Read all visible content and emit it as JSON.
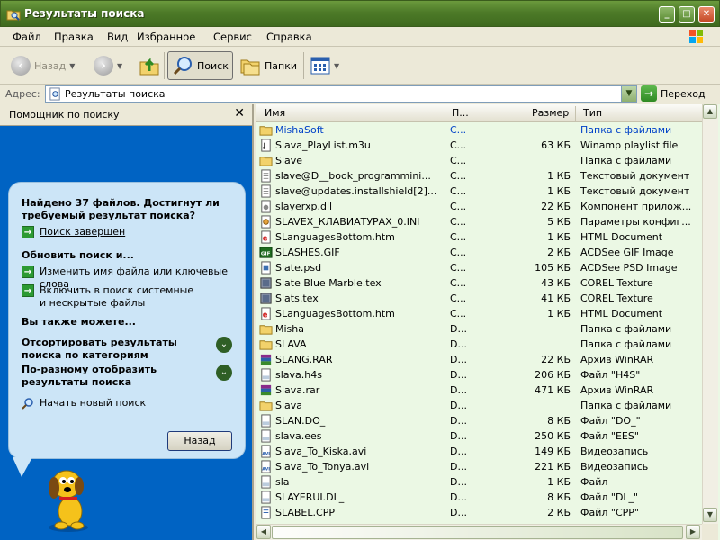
{
  "window": {
    "title": "Результаты поиска"
  },
  "menu": [
    "Файл",
    "Правка",
    "Вид",
    "Избранное",
    "Сервис",
    "Справка"
  ],
  "toolbar": {
    "back": "Назад",
    "search": "Поиск",
    "folders": "Папки"
  },
  "address": {
    "label": "Адрес:",
    "value": "Результаты поиска",
    "go": "Переход"
  },
  "left_panel": {
    "header": "Помощник по поиску",
    "found_text": "Найдено 37 файлов. Достигнут ли требуемый результат поиска?",
    "search_done": "Поиск завершен",
    "refine_title": "Обновить поиск и...",
    "refine_items": [
      "Изменить имя файла или ключевые слова",
      "Включить в поиск системные и нескрытые файлы"
    ],
    "also_title": "Вы также можете...",
    "sort_label": "Отсортировать результаты поиска по категориям",
    "view_label": "По-разному отобразить результаты поиска",
    "new_search": "Начать новый поиск",
    "back_button": "Назад"
  },
  "columns": {
    "name": "Имя",
    "path": "П...",
    "size": "Размер",
    "type": "Тип"
  },
  "files": [
    {
      "name": "MishaSoft",
      "path": "C...",
      "size": "",
      "type": "Папка с файлами",
      "icon": "folder-icon",
      "selected": true
    },
    {
      "name": "Slava_PlayList.m3u",
      "path": "C...",
      "size": "63 КБ",
      "type": "Winamp playlist file",
      "icon": "playlist-icon"
    },
    {
      "name": "Slave",
      "path": "C...",
      "size": "",
      "type": "Папка с файлами",
      "icon": "folder-icon"
    },
    {
      "name": "slave@D__book_programmini...",
      "path": "C...",
      "size": "1 КБ",
      "type": "Текстовый документ",
      "icon": "text-document-icon"
    },
    {
      "name": "slave@updates.installshield[2]...",
      "path": "C...",
      "size": "1 КБ",
      "type": "Текстовый документ",
      "icon": "text-document-icon"
    },
    {
      "name": "slayerxp.dll",
      "path": "C...",
      "size": "22 КБ",
      "type": "Компонент прилож...",
      "icon": "dll-icon"
    },
    {
      "name": "SLAVEX_КЛАВИАТУРАХ_0.INI",
      "path": "C...",
      "size": "5 КБ",
      "type": "Параметры конфиг...",
      "icon": "ini-icon"
    },
    {
      "name": "SLanguagesBottom.htm",
      "path": "C...",
      "size": "1 КБ",
      "type": "HTML Document",
      "icon": "html-icon"
    },
    {
      "name": "SLASHES.GIF",
      "path": "C...",
      "size": "2 КБ",
      "type": "ACDSee GIF Image",
      "icon": "gif-icon"
    },
    {
      "name": "Slate.psd",
      "path": "C...",
      "size": "105 КБ",
      "type": "ACDSee PSD Image",
      "icon": "psd-icon"
    },
    {
      "name": "Slate Blue Marble.tex",
      "path": "C...",
      "size": "43 КБ",
      "type": "COREL Texture",
      "icon": "texture-icon"
    },
    {
      "name": "Slats.tex",
      "path": "C...",
      "size": "41 КБ",
      "type": "COREL Texture",
      "icon": "texture-icon"
    },
    {
      "name": "SLanguagesBottom.htm",
      "path": "C...",
      "size": "1 КБ",
      "type": "HTML Document",
      "icon": "html-icon"
    },
    {
      "name": "Misha",
      "path": "D...",
      "size": "",
      "type": "Папка с файлами",
      "icon": "folder-icon"
    },
    {
      "name": "SLAVA",
      "path": "D...",
      "size": "",
      "type": "Папка с файлами",
      "icon": "folder-icon"
    },
    {
      "name": "SLANG.RAR",
      "path": "D...",
      "size": "22 КБ",
      "type": "Архив WinRAR",
      "icon": "rar-icon"
    },
    {
      "name": "slava.h4s",
      "path": "D...",
      "size": "206 КБ",
      "type": "Файл \"H4S\"",
      "icon": "generic-file-icon"
    },
    {
      "name": "Slava.rar",
      "path": "D...",
      "size": "471 КБ",
      "type": "Архив WinRAR",
      "icon": "rar-icon"
    },
    {
      "name": "Slava",
      "path": "D...",
      "size": "",
      "type": "Папка с файлами",
      "icon": "folder-icon"
    },
    {
      "name": "SLAN.DO_",
      "path": "D...",
      "size": "8 КБ",
      "type": "Файл \"DO_\"",
      "icon": "generic-file-icon"
    },
    {
      "name": "slava.ees",
      "path": "D...",
      "size": "250 КБ",
      "type": "Файл \"EES\"",
      "icon": "generic-file-icon"
    },
    {
      "name": "Slava_To_Kiska.avi",
      "path": "D...",
      "size": "149 КБ",
      "type": "Видеозапись",
      "icon": "video-icon"
    },
    {
      "name": "Slava_To_Tonya.avi",
      "path": "D...",
      "size": "221 КБ",
      "type": "Видеозапись",
      "icon": "video-icon"
    },
    {
      "name": "sla",
      "path": "D...",
      "size": "1 КБ",
      "type": "Файл",
      "icon": "generic-file-icon"
    },
    {
      "name": "SLAYERUI.DL_",
      "path": "D...",
      "size": "8 КБ",
      "type": "Файл \"DL_\"",
      "icon": "generic-file-icon"
    },
    {
      "name": "SLABEL.CPP",
      "path": "D...",
      "size": "2 КБ",
      "type": "Файл \"CPP\"",
      "icon": "cpp-icon"
    }
  ]
}
